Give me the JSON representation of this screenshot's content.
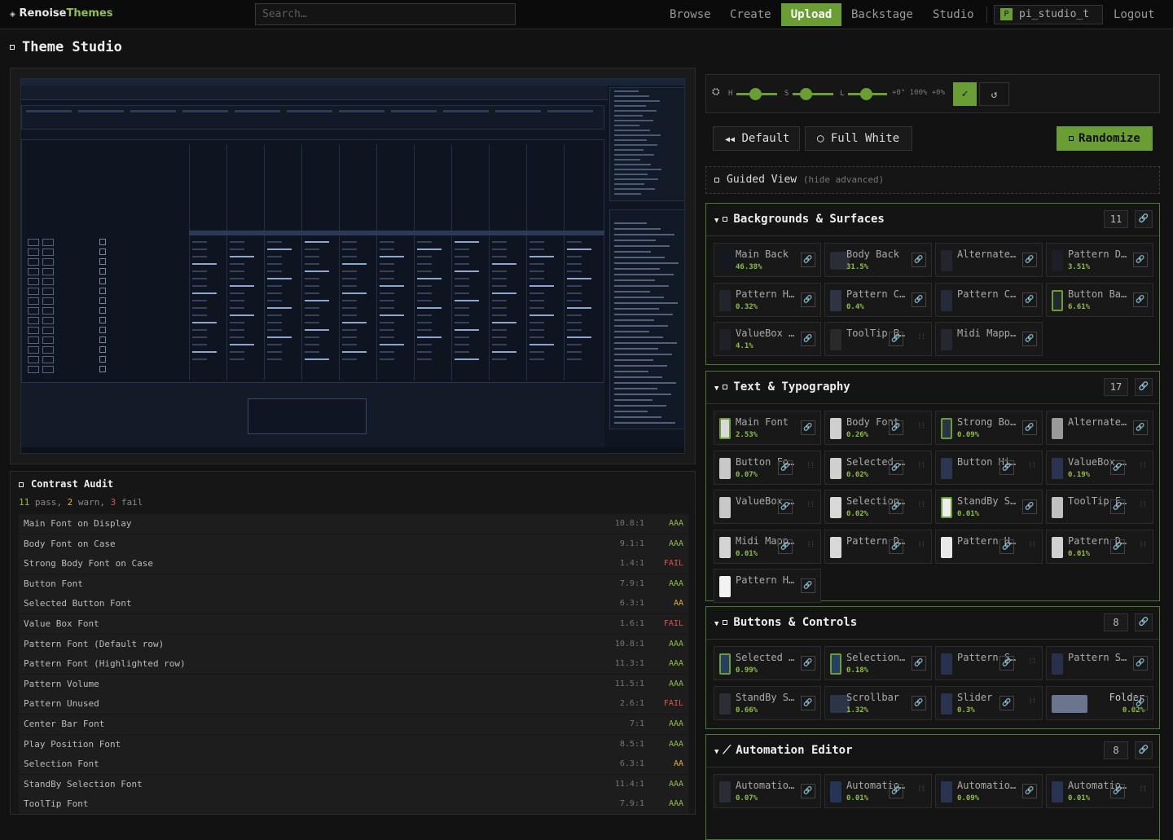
{
  "app": {
    "logo_a": "Renoise",
    "logo_b": "Themes",
    "search_placeholder": "Search…"
  },
  "nav": [
    {
      "label": "Browse"
    },
    {
      "label": "Create"
    },
    {
      "label": "Upload",
      "active": true
    },
    {
      "label": "Backstage"
    },
    {
      "label": "Studio"
    }
  ],
  "user": {
    "avatar": "P",
    "name": "pi_studio_t",
    "logout": "Logout"
  },
  "page": {
    "title": "Theme Studio"
  },
  "hsl": {
    "h": "H",
    "s": "S",
    "l": "L",
    "values": "+0° 100% +0%",
    "apply": "✓",
    "reset": "↺"
  },
  "presets": {
    "default": "Default",
    "white": "Full White",
    "random": "Randomize"
  },
  "guided": {
    "label": "Guided View",
    "hint": "(hide advanced)"
  },
  "audit": {
    "title": "Contrast Audit",
    "pass": "11",
    "pass_l": "pass,",
    "warn": "2",
    "warn_l": "warn,",
    "fail": "3",
    "fail_l": "fail",
    "rows": [
      {
        "label": "Main Font on Display",
        "ratio": "10.8:1",
        "status": "AAA"
      },
      {
        "label": "Body Font on Case",
        "ratio": "9.1:1",
        "status": "AAA"
      },
      {
        "label": "Strong Body Font on Case",
        "ratio": "1.4:1",
        "status": "FAIL"
      },
      {
        "label": "Button Font",
        "ratio": "7.9:1",
        "status": "AAA"
      },
      {
        "label": "Selected Button Font",
        "ratio": "6.3:1",
        "status": "AA"
      },
      {
        "label": "Value Box Font",
        "ratio": "1.6:1",
        "status": "FAIL"
      },
      {
        "label": "Pattern Font (Default row)",
        "ratio": "10.8:1",
        "status": "AAA"
      },
      {
        "label": "Pattern Font (Highlighted row)",
        "ratio": "11.3:1",
        "status": "AAA"
      },
      {
        "label": "Pattern Volume",
        "ratio": "11.5:1",
        "status": "AAA"
      },
      {
        "label": "Pattern Unused",
        "ratio": "2.6:1",
        "status": "FAIL"
      },
      {
        "label": "Center Bar Font",
        "ratio": "7:1",
        "status": "AAA"
      },
      {
        "label": "Play Position Font",
        "ratio": "8.5:1",
        "status": "AAA"
      },
      {
        "label": "Selection Font",
        "ratio": "6.3:1",
        "status": "AA"
      },
      {
        "label": "StandBy Selection Font",
        "ratio": "11.4:1",
        "status": "AAA"
      },
      {
        "label": "ToolTip Font",
        "ratio": "7.9:1",
        "status": "AAA"
      }
    ]
  },
  "sections": [
    {
      "name": "Backgrounds & Surfaces",
      "count": "11",
      "icon": "square",
      "cards": [
        {
          "name": "Main Back",
          "pct": "46.38%",
          "color": "#141820",
          "large": true
        },
        {
          "name": "Body Back",
          "pct": "31.5%",
          "color": "#2a2d36",
          "large": true
        },
        {
          "name": "Alternate Back",
          "pct": "",
          "color": "#23262e"
        },
        {
          "name": "Pattern Default Back",
          "pct": "3.51%",
          "color": "#1c1f27"
        },
        {
          "name": "Pattern Highlighted Back",
          "pct": "0.32%",
          "color": "#22252d"
        },
        {
          "name": "Pattern Centerbar Back",
          "pct": "0.4%",
          "color": "#2e3444"
        },
        {
          "name": "Pattern Centerbar Back Standby",
          "pct": "",
          "color": "#262b38"
        },
        {
          "name": "Button Back",
          "pct": "6.61%",
          "color": "#24282f",
          "ring": true
        },
        {
          "name": "ValueBox Back",
          "pct": "4.1%",
          "color": "#1e2128"
        },
        {
          "name": "ToolTip Back",
          "pct": "",
          "color": "#2a2a2a",
          "dots": true
        },
        {
          "name": "Midi Mapping Back",
          "pct": "",
          "color": "#252830"
        }
      ]
    },
    {
      "name": "Text & Typography",
      "count": "17",
      "icon": "square",
      "cards": [
        {
          "name": "Main Font",
          "pct": "2.53%",
          "color": "#d8d8d8",
          "ring": true
        },
        {
          "name": "Body Font",
          "pct": "0.26%",
          "color": "#cfcfcf",
          "dots": true
        },
        {
          "name": "Strong Body Font",
          "pct": "0.09%",
          "color": "#2c3448",
          "ring": true
        },
        {
          "name": "Alternate Main Font",
          "pct": "",
          "color": "#9a9a9a"
        },
        {
          "name": "Button Font",
          "pct": "0.07%",
          "color": "#c8c8c8",
          "dots": true
        },
        {
          "name": "Selected Button Font",
          "pct": "0.02%",
          "color": "#d0d0d0",
          "dots": true
        },
        {
          "name": "Button Highlight Font",
          "pct": "",
          "color": "#2b3650",
          "dots": true
        },
        {
          "name": "ValueBox Font",
          "pct": "0.19%",
          "color": "#2a3450",
          "dots": true
        },
        {
          "name": "ValueBox Font Icons",
          "pct": "",
          "color": "#c8c8c8",
          "dots": true
        },
        {
          "name": "Selection Font",
          "pct": "0.02%",
          "color": "#d8d8d8",
          "dots": true
        },
        {
          "name": "StandBy Selection Font",
          "pct": "0.01%",
          "color": "#eeeeee",
          "ring": true
        },
        {
          "name": "ToolTip Font",
          "pct": "",
          "color": "#c0c0c0",
          "dots": true
        },
        {
          "name": "Midi Mapping Font",
          "pct": "0.01%",
          "color": "#d4d4d4",
          "dots": true
        },
        {
          "name": "Pattern Default Font",
          "pct": "",
          "color": "#d8d8d8",
          "dots": true
        },
        {
          "name": "Pattern Highlighted Font",
          "pct": "",
          "color": "#e8e8e8",
          "dots": true
        },
        {
          "name": "Pattern Default Number",
          "pct": "0.01%",
          "color": "#d0d0d0",
          "dots": true
        },
        {
          "name": "Pattern Highlighted Number",
          "pct": "",
          "color": "#f2f2f2"
        }
      ]
    },
    {
      "name": "Buttons & Controls",
      "count": "8",
      "icon": "square",
      "cards": [
        {
          "name": "Selected Button Back",
          "pct": "0.99%",
          "color": "#263e62",
          "ring": true
        },
        {
          "name": "Selection Back",
          "pct": "0.18%",
          "color": "#263e62",
          "ring": true
        },
        {
          "name": "Pattern Selection",
          "pct": "",
          "color": "#27334e",
          "dots": true
        },
        {
          "name": "Pattern Standby Selection",
          "pct": "",
          "color": "#28304a"
        },
        {
          "name": "StandBy Selection Back",
          "pct": "0.66%",
          "color": "#2b2e36"
        },
        {
          "name": "Scrollbar",
          "pct": "1.32%",
          "color": "#2c3448",
          "large": true
        },
        {
          "name": "Slider",
          "pct": "0.3%",
          "color": "#2a3450",
          "dots": true
        },
        {
          "name": "Folder",
          "pct": "0.02%",
          "color": "#6a7590",
          "large": true,
          "wide": true
        }
      ]
    },
    {
      "name": "Automation Editor",
      "count": "8",
      "icon": "chart",
      "cards": [
        {
          "name": "Automation Grid",
          "pct": "0.07%",
          "color": "#2a2d36"
        },
        {
          "name": "Automation Line Edge",
          "pct": "0.01%",
          "color": "#263456",
          "dots": true
        },
        {
          "name": "Automation Line Fill",
          "pct": "0.09%",
          "color": "#2a3452"
        },
        {
          "name": "Automation Point",
          "pct": "0.01%",
          "color": "#2a3452",
          "dots": true
        }
      ]
    }
  ]
}
